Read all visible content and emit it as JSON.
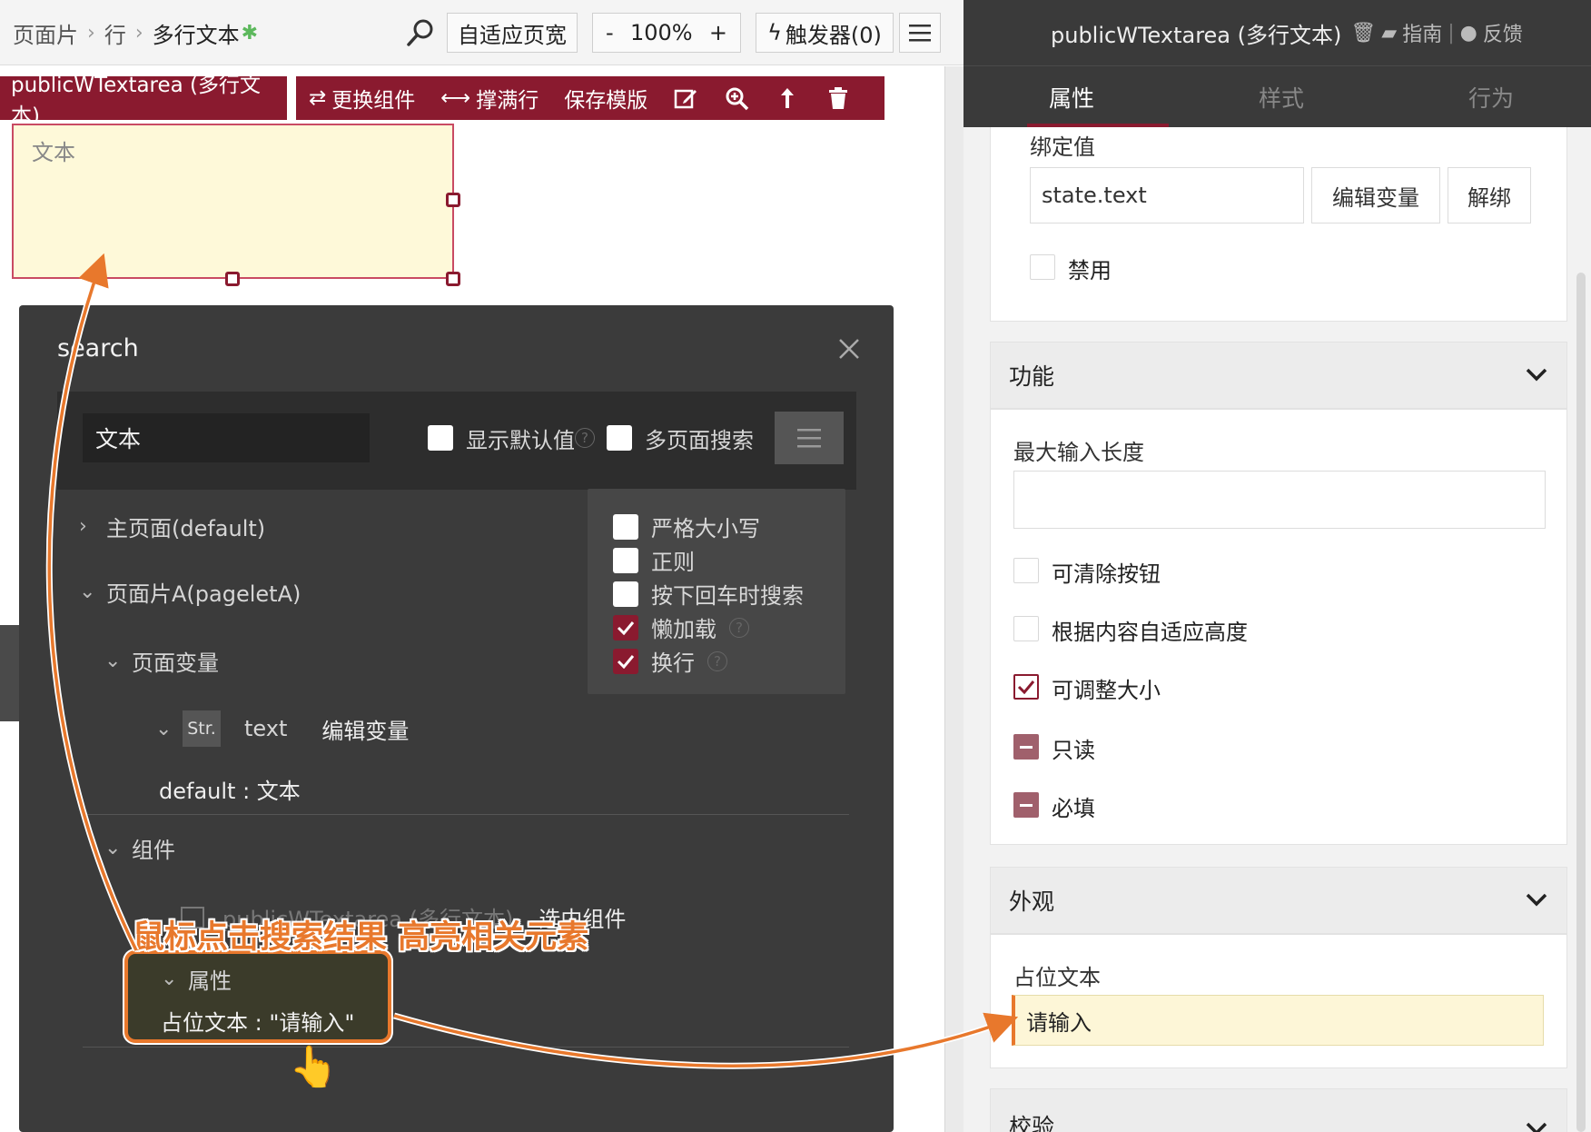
{
  "topbar": {
    "crumbs": [
      "页面片",
      "行",
      "多行文本"
    ],
    "fit_width": "自适应页宽",
    "zoom_minus": "-",
    "zoom": "100%",
    "zoom_plus": "+",
    "triggers": "触发器(0)"
  },
  "component": {
    "name": "publicWTextarea (多行文本)",
    "actions": [
      "更换组件",
      "撑满行",
      "保存模版"
    ],
    "textarea_placeholder": "文本"
  },
  "search_dialog": {
    "title": "search",
    "query": "文本",
    "show_default": "显示默认值",
    "multi_page": "多页面搜索",
    "options": [
      {
        "label": "严格大小写",
        "checked": false
      },
      {
        "label": "正则",
        "checked": false
      },
      {
        "label": "按下回车时搜索",
        "checked": false
      },
      {
        "label": "懒加载",
        "checked": true
      },
      {
        "label": "换行",
        "checked": true
      }
    ],
    "tree": {
      "main_page": "主页面(default)",
      "pagelet": "页面片A(pageletA)",
      "page_vars": "页面变量",
      "var_type": "Str.",
      "var_name": "text",
      "edit_var": "编辑变量",
      "var_default": "default : 文本",
      "components": "组件",
      "comp_result": "publicWTextarea (多行文本)",
      "select_comp": "选中组件",
      "props": "属性",
      "prop_result": "占位文本 : \"请输入\""
    }
  },
  "annotation": {
    "callout": "鼠标点击搜索结果 高亮相关元素"
  },
  "right_panel": {
    "title": "publicWTextarea (多行文本)",
    "guide": "指南",
    "feedback": "反馈",
    "tabs": [
      "属性",
      "样式",
      "行为"
    ],
    "bind_label": "绑定值",
    "bind_value": "state.text",
    "edit_var": "编辑变量",
    "unbind": "解绑",
    "disabled": "禁用",
    "section_function": "功能",
    "max_length": "最大输入长度",
    "max_length_value": "",
    "clearable": "可清除按钮",
    "autosize": "根据内容自适应高度",
    "resizable": "可调整大小",
    "readonly": "只读",
    "required": "必填",
    "section_appearance": "外观",
    "placeholder_label": "占位文本",
    "placeholder_value": "请输入",
    "section_validation": "校验"
  },
  "colors": {
    "brand": "#8a1a2f",
    "annotation": "#e8782c",
    "dialog_bg": "#3b3b3b",
    "highlight_bg": "#fef9d9"
  }
}
